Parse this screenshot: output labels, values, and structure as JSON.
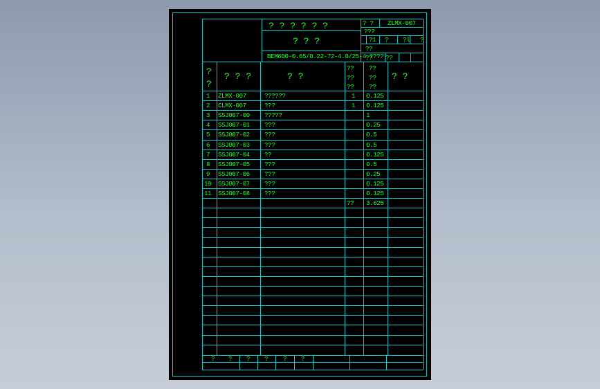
{
  "title_block": {
    "name_cn": "? ? ? ?  ? ?",
    "subtitle": "? ? ?",
    "spec": "BEM600-0.65/0.22-72-4.0/25-4 ????",
    "r1a": "?    ?",
    "r1b": "ZLMX-007",
    "r2": "???",
    "r3a": "?1",
    "r3b": "?",
    "r3c": "?l",
    "r3d": "?",
    "r4": "??",
    "r5a": "??",
    "r5b": "??"
  },
  "headers": {
    "h1a": "?",
    "h1b": "?",
    "h2": "? ? ?",
    "h3": "?       ?",
    "h4a": "??",
    "h4b": "??",
    "h4c": "??",
    "h5a": "??",
    "h5b": "??",
    "h5c": "??",
    "h6": "?     ?"
  },
  "rows": [
    {
      "no": "1",
      "code": "ZLMX-007",
      "name": "??????",
      "qty": "1",
      "val": "0.125"
    },
    {
      "no": "2",
      "code": "CLMX-007",
      "name": "???",
      "qty": "1",
      "val": "0.125"
    },
    {
      "no": "3",
      "code": "SSJ007-00",
      "name": "?????",
      "qty": "",
      "val": "1"
    },
    {
      "no": "4",
      "code": "SSJ007-01",
      "name": "???",
      "qty": "",
      "val": "0.25"
    },
    {
      "no": "5",
      "code": "SSJ007-02",
      "name": "???",
      "qty": "",
      "val": "0.5"
    },
    {
      "no": "6",
      "code": "SSJ007-03",
      "name": "???",
      "qty": "",
      "val": "0.5"
    },
    {
      "no": "7",
      "code": "SSJ007-04",
      "name": "??",
      "qty": "",
      "val": "0.125"
    },
    {
      "no": "8",
      "code": "SSJ007-05",
      "name": "???",
      "qty": "",
      "val": "0.5"
    },
    {
      "no": "9",
      "code": "SSJ007-06",
      "name": "???",
      "qty": "",
      "val": "0.25"
    },
    {
      "no": "10",
      "code": "SSJ007-07",
      "name": "???",
      "qty": "",
      "val": "0.125"
    },
    {
      "no": "11",
      "code": "SSJ007-08",
      "name": "???",
      "qty": "",
      "val": "0.125"
    }
  ],
  "total": {
    "label": "??",
    "value": "3.625"
  },
  "footer": [
    "?",
    "?",
    "?",
    "?",
    "?",
    "?"
  ]
}
